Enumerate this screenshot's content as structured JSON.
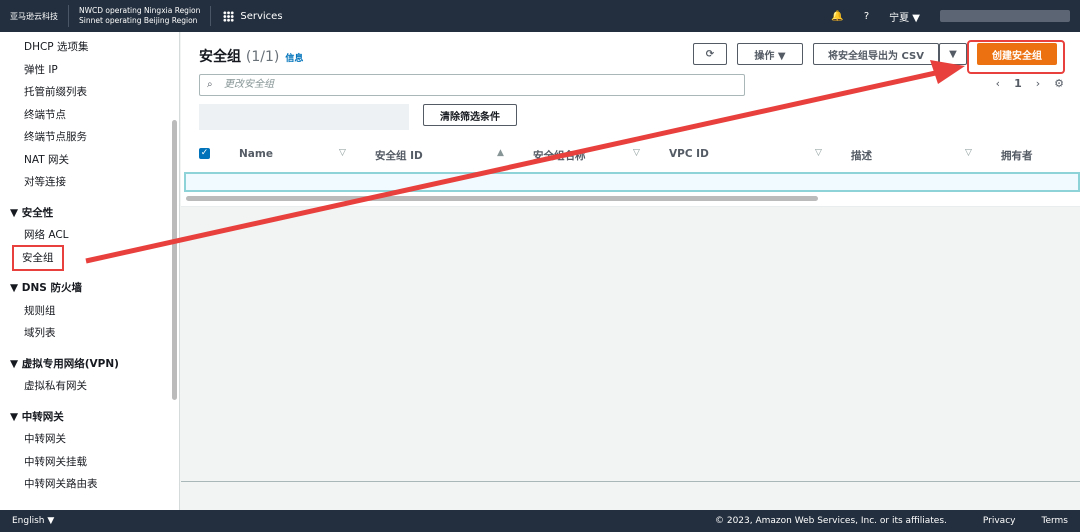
{
  "header": {
    "logo": "亚马逊云科技",
    "region_line1": "NWCD operating Ningxia Region",
    "region_line2": "Sinnet operating Beijing Region",
    "services": "Services",
    "region_select": "宁夏 ▼"
  },
  "sidebar": {
    "items": [
      "DHCP 选项集",
      "弹性 IP",
      "托管前缀列表",
      "终端节点",
      "终端节点服务",
      "NAT 网关",
      "对等连接"
    ],
    "sections": [
      {
        "title": "▼ 安全性",
        "items": [
          "网络 ACL",
          "安全组"
        ]
      },
      {
        "title": "▼ DNS 防火墙",
        "items": [
          "规则组",
          "域列表"
        ]
      },
      {
        "title": "▼ 虚拟专用网络(VPN)",
        "items": [
          "虚拟私有网关"
        ]
      },
      {
        "title": "▼ 中转网关",
        "items": [
          "中转网关",
          "中转网关挂载",
          "中转网关路由表"
        ]
      }
    ]
  },
  "main": {
    "title": "安全组",
    "count": "(1/1)",
    "info": "信息",
    "actions": "操作 ▼",
    "export": "将安全组导出为 CSV",
    "create": "创建安全组",
    "search_placeholder": "更改安全组",
    "clear": "清除筛选条件",
    "page": "1",
    "columns": [
      "Name",
      "安全组 ID",
      "安全组名称",
      "VPC ID",
      "描述",
      "拥有者"
    ]
  },
  "footer": {
    "language": "English ▼",
    "copyright": "© 2023, Amazon Web Services, Inc. or its affiliates.",
    "privacy": "Privacy",
    "terms": "Terms"
  }
}
